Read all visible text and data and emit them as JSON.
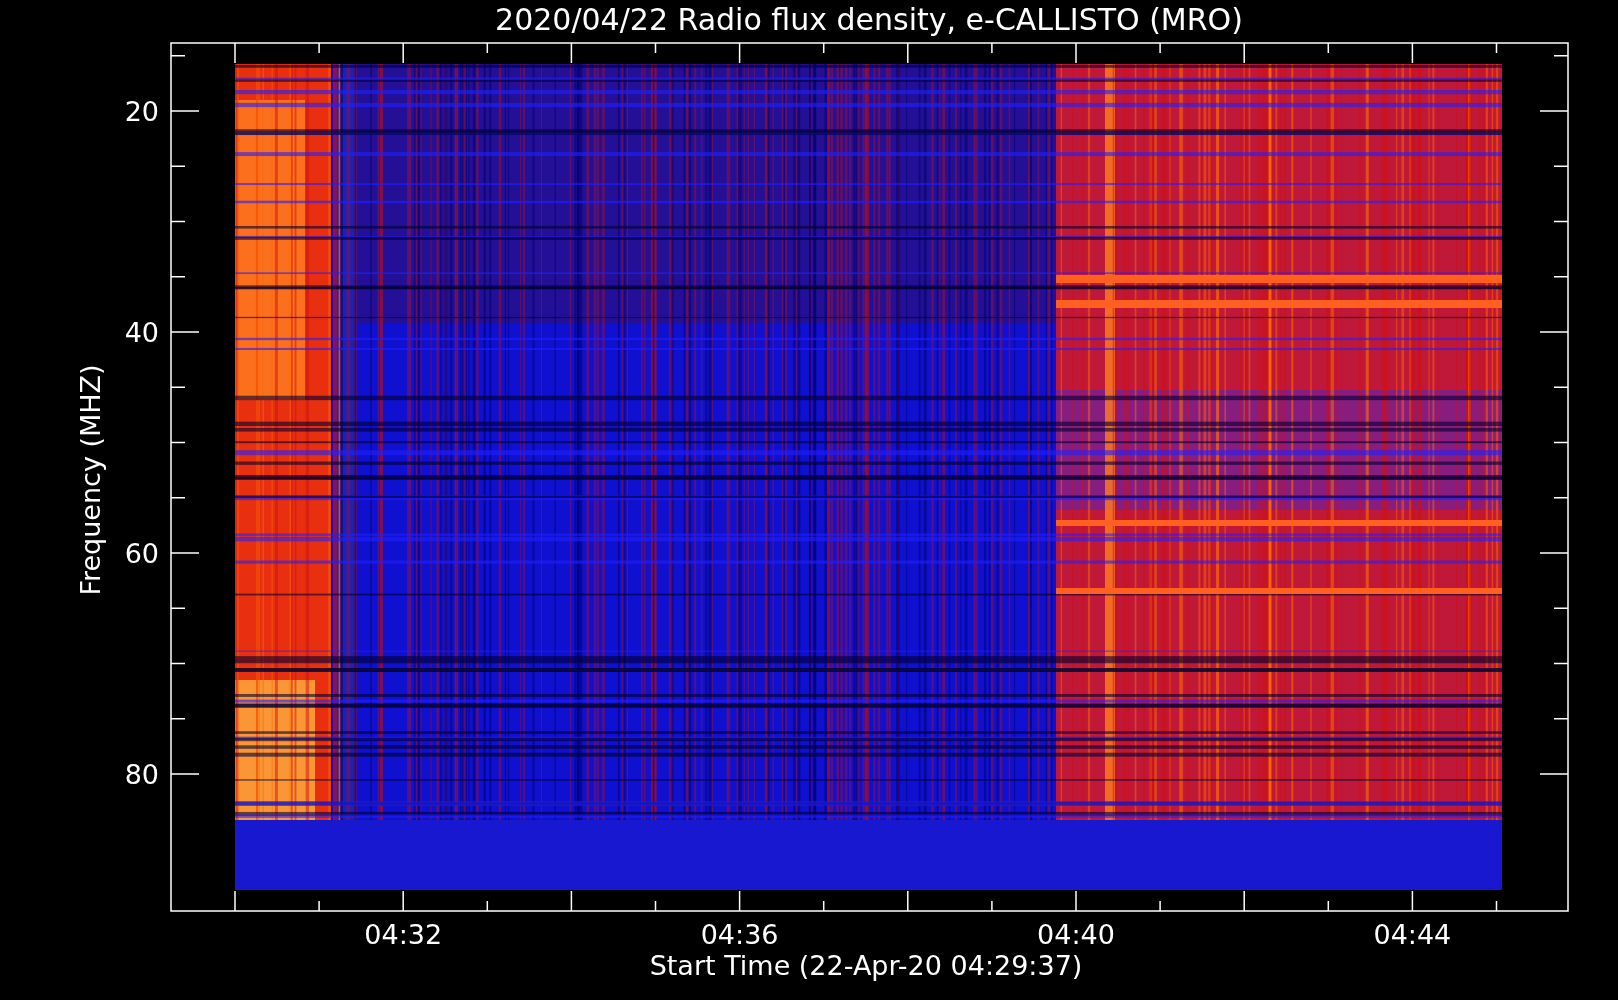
{
  "title": "2020/04/22  Radio flux density, e-CALLISTO (MRO)",
  "x_axis": {
    "label": "Start Time (22-Apr-20 04:29:37)",
    "ticks": [
      "04:32",
      "04:36",
      "04:40",
      "04:44"
    ]
  },
  "y_axis": {
    "label": "Frequency (MHZ)",
    "ticks": [
      "20",
      "40",
      "60",
      "80"
    ]
  }
}
